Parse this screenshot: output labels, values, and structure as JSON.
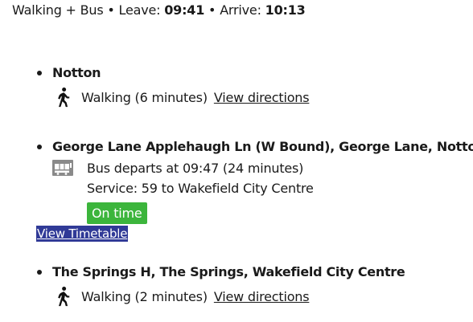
{
  "summary": {
    "mode": "Walking + Bus",
    "leave_label": "Leave:",
    "leave_time": "09:41",
    "arrive_label": "Arrive:",
    "arrive_time": "10:13",
    "separator": "•"
  },
  "stops": [
    {
      "name": "Notton",
      "leg": {
        "icon": "walking-person-icon",
        "text": "Walking (6 minutes)",
        "link": "View directions"
      }
    },
    {
      "name": "George Lane Applehaugh Ln (W Bound), George Lane, Notton",
      "leg": {
        "icon": "bus-icon",
        "text": "Bus departs at 09:47 (24 minutes)",
        "service": "Service: 59 to Wakefield City Centre",
        "status": "On time",
        "status_color": "#3cb53c",
        "timetable_link": "View Timetable"
      }
    },
    {
      "name": "The Springs H, The Springs, Wakefield City Centre",
      "leg": {
        "icon": "walking-person-icon",
        "text": "Walking (2 minutes)",
        "link": "View directions"
      }
    }
  ]
}
